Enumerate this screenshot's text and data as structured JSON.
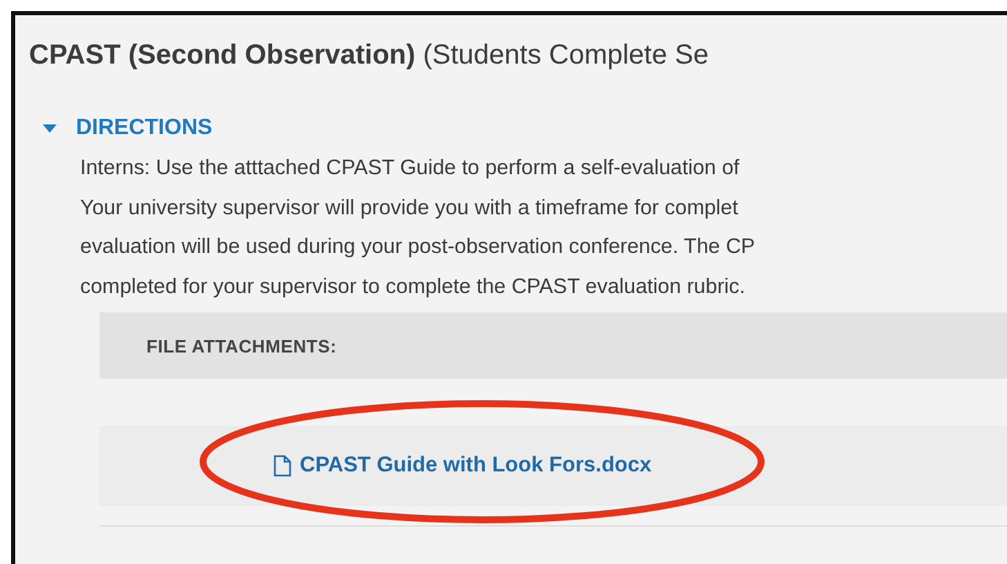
{
  "title": "**CPAST (Second Observation)** (Students Complete Se",
  "section": {
    "heading": "DIRECTIONS",
    "expanded": true,
    "lines": [
      "Interns: Use the atttached CPAST Guide to perform a self-evaluation of",
      "Your university supervisor will provide you with a timeframe for complet",
      "evaluation will be used during your post-observation conference. The CP",
      "completed for your supervisor to complete the CPAST evaluation rubric."
    ],
    "attachments_label": "FILE ATTACHMENTS:",
    "attachments": [
      {
        "name": "CPAST Guide with Look Fors.docx"
      }
    ]
  },
  "annotation": {
    "kind": "ellipse"
  }
}
